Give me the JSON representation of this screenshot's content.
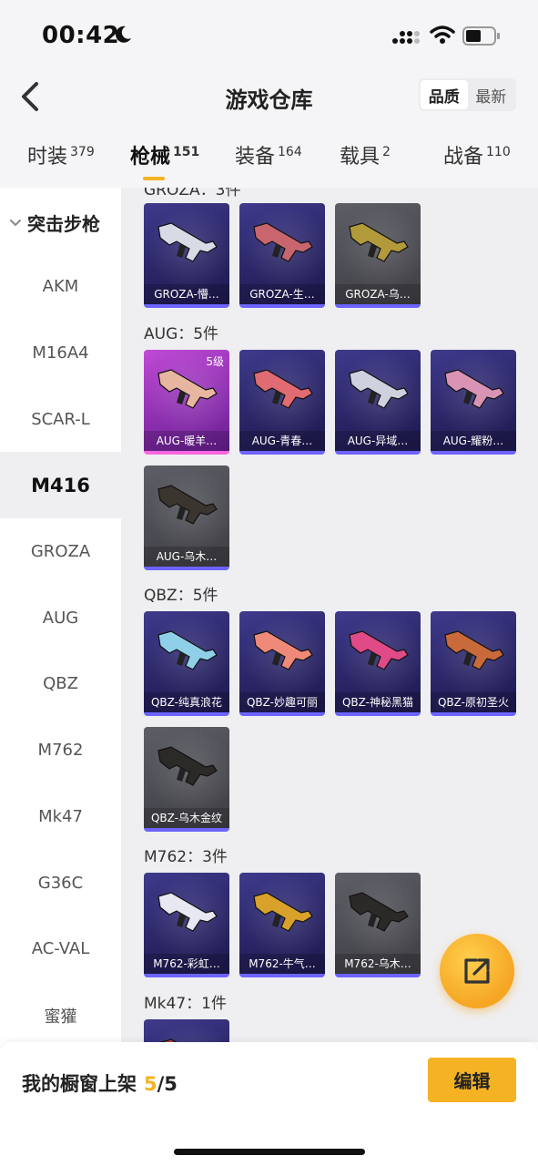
{
  "status": {
    "time": "00:42"
  },
  "header": {
    "title": "游戏仓库",
    "sort_options": [
      "品质",
      "最新"
    ],
    "active_sort": "品质"
  },
  "tabs": [
    {
      "label": "时装",
      "count": "379"
    },
    {
      "label": "枪械",
      "count": "151"
    },
    {
      "label": "装备",
      "count": "164"
    },
    {
      "label": "载具",
      "count": "2"
    },
    {
      "label": "战备",
      "count": "110"
    }
  ],
  "sidebar": {
    "heading": "突击步枪",
    "items": [
      "AKM",
      "M16A4",
      "SCAR-L",
      "M416",
      "GROZA",
      "AUG",
      "QBZ",
      "M762",
      "Mk47",
      "G36C",
      "AC-VAL",
      "蜜獾"
    ],
    "active": "M416"
  },
  "sections": [
    {
      "label": "GROZA：3件",
      "items": [
        {
          "name": "GROZA-懵…",
          "rarity": "purple"
        },
        {
          "name": "GROZA-生…",
          "rarity": "purple"
        },
        {
          "name": "GROZA-乌…",
          "rarity": "gray"
        }
      ]
    },
    {
      "label": "AUG：5件",
      "items": [
        {
          "name": "AUG-暖羊…",
          "rarity": "pink",
          "level": "5级"
        },
        {
          "name": "AUG-青春…",
          "rarity": "purple"
        },
        {
          "name": "AUG-异域…",
          "rarity": "purple"
        },
        {
          "name": "AUG-耀粉…",
          "rarity": "purple"
        },
        {
          "name": "AUG-乌木…",
          "rarity": "gray"
        }
      ]
    },
    {
      "label": "QBZ：5件",
      "items": [
        {
          "name": "QBZ-纯真浪花",
          "rarity": "purple"
        },
        {
          "name": "QBZ-妙趣可丽",
          "rarity": "purple"
        },
        {
          "name": "QBZ-神秘黑猫",
          "rarity": "purple"
        },
        {
          "name": "QBZ-原初圣火",
          "rarity": "purple"
        },
        {
          "name": "QBZ-乌木金纹",
          "rarity": "gray"
        }
      ]
    },
    {
      "label": "M762：3件",
      "items": [
        {
          "name": "M762-彩虹…",
          "rarity": "purple"
        },
        {
          "name": "M762-牛气…",
          "rarity": "purple"
        },
        {
          "name": "M762-乌木…",
          "rarity": "gray"
        }
      ]
    },
    {
      "label": "Mk47：1件",
      "items": [
        {
          "name": "",
          "rarity": "purple"
        }
      ]
    }
  ],
  "bottom": {
    "shelf_label": "我的橱窗上架",
    "shelf_count": "5",
    "shelf_total": "/5",
    "edit_label": "编辑"
  },
  "colors": {
    "accent": "#f5b324",
    "purple_card": "#2a2566",
    "gray_card": "#494950",
    "pink_card": "#8d2fb0"
  }
}
